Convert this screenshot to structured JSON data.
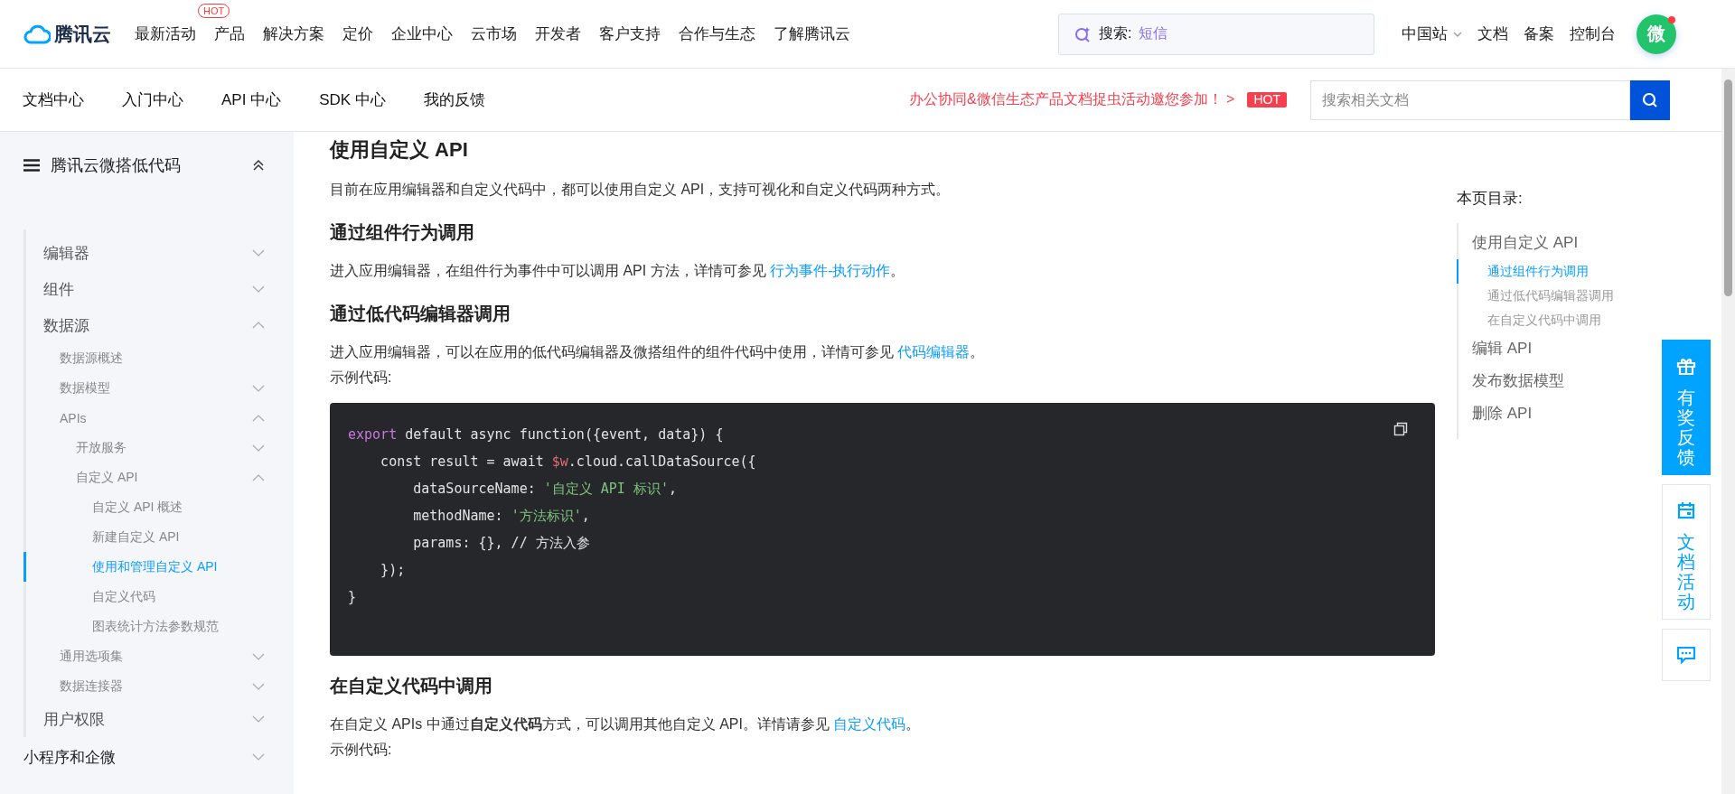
{
  "topbar": {
    "logo": "腾讯云",
    "nav": [
      {
        "label": "最新活动"
      },
      {
        "label": "产品",
        "badge": "HOT"
      },
      {
        "label": "解决方案"
      },
      {
        "label": "定价"
      },
      {
        "label": "企业中心"
      },
      {
        "label": "云市场"
      },
      {
        "label": "开发者"
      },
      {
        "label": "客户支持"
      },
      {
        "label": "合作与生态"
      },
      {
        "label": "了解腾讯云"
      }
    ],
    "search": {
      "label": "搜索:",
      "value": "短信"
    },
    "links": [
      {
        "label": "中国站",
        "dropdown": true
      },
      {
        "label": "文档",
        "dropdown": false
      },
      {
        "label": "备案",
        "dropdown": false
      },
      {
        "label": "控制台",
        "dropdown": false
      }
    ],
    "avatar": {
      "text": "微",
      "notification": true
    }
  },
  "docbar": {
    "tabs": [
      "文档中心",
      "入门中心",
      "API 中心",
      "SDK 中心",
      "我的反馈"
    ],
    "promo": {
      "text": "办公协同&微信生态产品文档捉虫活动邀您参加！ >",
      "badge": "HOT"
    },
    "search": {
      "placeholder": "搜索相关文档"
    }
  },
  "sidebar": {
    "title": "腾讯云微搭低代码",
    "collapsed": false,
    "items": [
      {
        "label": "编辑器",
        "expanded": false,
        "selected": false
      },
      {
        "label": "组件",
        "expanded": false,
        "selected": false
      },
      {
        "label": "数据源",
        "expanded": true,
        "selected": false,
        "children": [
          {
            "label": "数据源概述",
            "selected": false
          },
          {
            "label": "数据模型",
            "expanded": false,
            "selected": false
          },
          {
            "label": "APIs",
            "expanded": true,
            "selected": false,
            "children": [
              {
                "label": "开放服务",
                "expanded": false,
                "selected": false
              },
              {
                "label": "自定义 API",
                "expanded": true,
                "selected": false,
                "children": [
                  {
                    "label": "自定义 API 概述",
                    "selected": false
                  },
                  {
                    "label": "新建自定义 API",
                    "selected": false
                  },
                  {
                    "label": "使用和管理自定义 API",
                    "selected": true
                  },
                  {
                    "label": "自定义代码",
                    "selected": false
                  },
                  {
                    "label": "图表统计方法参数规范",
                    "selected": false
                  }
                ]
              }
            ]
          },
          {
            "label": "通用选项集",
            "expanded": false,
            "selected": false
          },
          {
            "label": "数据连接器",
            "expanded": false,
            "selected": false
          }
        ]
      },
      {
        "label": "用户权限",
        "expanded": false,
        "selected": false
      }
    ],
    "sections": [
      {
        "label": "小程序和企微",
        "expanded": false
      }
    ]
  },
  "article": {
    "blocks": [
      {
        "kind": "h2",
        "text": "使用自定义 API"
      },
      {
        "kind": "p",
        "segments": [
          {
            "text": "目前在应用编辑器和自定义代码中，都可以使用自定义 API，支持可视化和自定义代码两种方式。"
          }
        ]
      },
      {
        "kind": "h3",
        "text": "通过组件行为调用"
      },
      {
        "kind": "p",
        "segments": [
          {
            "text": "进入应用编辑器，在组件行为事件中可以调用 API 方法，详情可参见 "
          },
          {
            "text": "行为事件-执行动作",
            "link": true
          },
          {
            "text": "。"
          }
        ]
      },
      {
        "kind": "h3",
        "text": "通过低代码编辑器调用"
      },
      {
        "kind": "p",
        "segments": [
          {
            "text": "进入应用编辑器，可以在应用的低代码编辑器及微搭组件的组件代码中使用，详情可参见 "
          },
          {
            "text": "代码编辑器",
            "link": true
          },
          {
            "text": "。"
          }
        ]
      },
      {
        "kind": "p",
        "segments": [
          {
            "text": "示例代码:"
          }
        ]
      },
      {
        "kind": "code",
        "lines": [
          [
            {
              "text": "export",
              "kind": "keyword"
            },
            {
              "text": " default async function({event, data}) {",
              "kind": "plain"
            }
          ],
          [
            {
              "text": "    const result = await ",
              "kind": "plain"
            },
            {
              "text": "$w",
              "kind": "variable"
            },
            {
              "text": ".cloud.callDataSource({",
              "kind": "plain"
            }
          ],
          [
            {
              "text": "        dataSourceName: ",
              "kind": "plain"
            },
            {
              "text": "'自定义 API 标识'",
              "kind": "string"
            },
            {
              "text": ",",
              "kind": "plain"
            }
          ],
          [
            {
              "text": "        methodName: ",
              "kind": "plain"
            },
            {
              "text": "'方法标识'",
              "kind": "string"
            },
            {
              "text": ",",
              "kind": "plain"
            }
          ],
          [
            {
              "text": "        params: {}, // 方法入参",
              "kind": "plain"
            }
          ],
          [
            {
              "text": "    });",
              "kind": "plain"
            }
          ],
          [
            {
              "text": "}",
              "kind": "plain"
            }
          ]
        ]
      },
      {
        "kind": "h3",
        "text": "在自定义代码中调用"
      },
      {
        "kind": "p",
        "segments": [
          {
            "text": "在自定义 APIs 中通过**自定义代码**方式，可以调用其他自定义 API。详情请参见 "
          },
          {
            "text": "自定义代码",
            "link": true
          },
          {
            "text": "。"
          }
        ]
      },
      {
        "kind": "p",
        "segments": [
          {
            "text": "示例代码:"
          }
        ]
      }
    ]
  },
  "toc": {
    "title": "本页目录:",
    "items": [
      {
        "label": "使用自定义 API",
        "selected": false,
        "children": [
          {
            "label": "通过组件行为调用",
            "selected": true
          },
          {
            "label": "通过低代码编辑器调用",
            "selected": false
          },
          {
            "label": "在自定义代码中调用",
            "selected": false
          }
        ]
      },
      {
        "label": "编辑 API",
        "selected": false
      },
      {
        "label": "发布数据模型",
        "selected": false
      },
      {
        "label": "删除 API",
        "selected": false
      }
    ]
  },
  "float_buttons": [
    {
      "kind": "gift",
      "label": "有奖反馈",
      "selected": true
    },
    {
      "kind": "calendar",
      "label": "文档活动",
      "selected": false
    },
    {
      "kind": "chat",
      "selected": false
    }
  ]
}
